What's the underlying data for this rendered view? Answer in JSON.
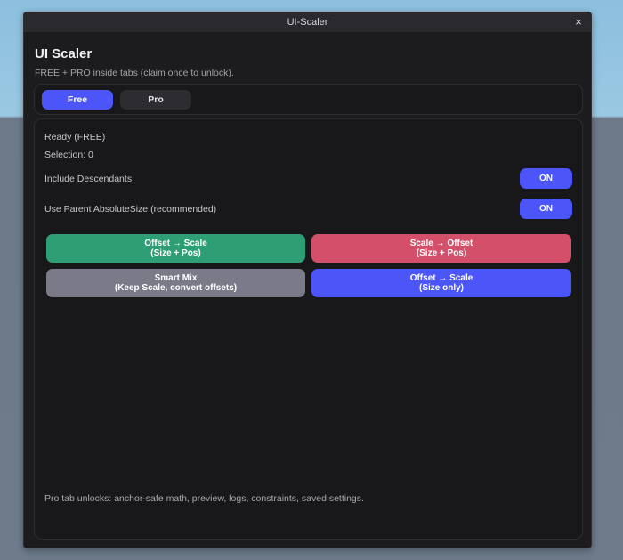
{
  "window": {
    "title": "UI-Scaler",
    "close_label": "×"
  },
  "header": {
    "title": "UI Scaler",
    "subtitle": "FREE + PRO inside tabs (claim once to unlock)."
  },
  "tabs": [
    {
      "label": "Free",
      "active": true
    },
    {
      "label": "Pro",
      "active": false
    }
  ],
  "status": {
    "ready": "Ready (FREE)",
    "selection": "Selection: 0"
  },
  "options": [
    {
      "label": "Include Descendants",
      "toggle": "ON"
    },
    {
      "label": "Use Parent AbsoluteSize (recommended)",
      "toggle": "ON"
    }
  ],
  "actions": [
    {
      "line1": "Offset → Scale",
      "line2": "(Size + Pos)",
      "color": "#2e9e74"
    },
    {
      "line1": "Scale → Offset",
      "line2": "(Size + Pos)",
      "color": "#d4506a"
    },
    {
      "line1": "Smart Mix",
      "line2": "(Keep Scale, convert offsets)",
      "color": "#7a7a88"
    },
    {
      "line1": "Offset → Scale",
      "line2": "(Size only)",
      "color": "#4b55f8"
    }
  ],
  "footer": {
    "note": "Pro tab unlocks: anchor-safe math, preview, logs, constraints, saved settings."
  },
  "colors": {
    "accent": "#4b55f8",
    "panel_bg": "#18181b",
    "window_bg": "#1c1c1f"
  }
}
